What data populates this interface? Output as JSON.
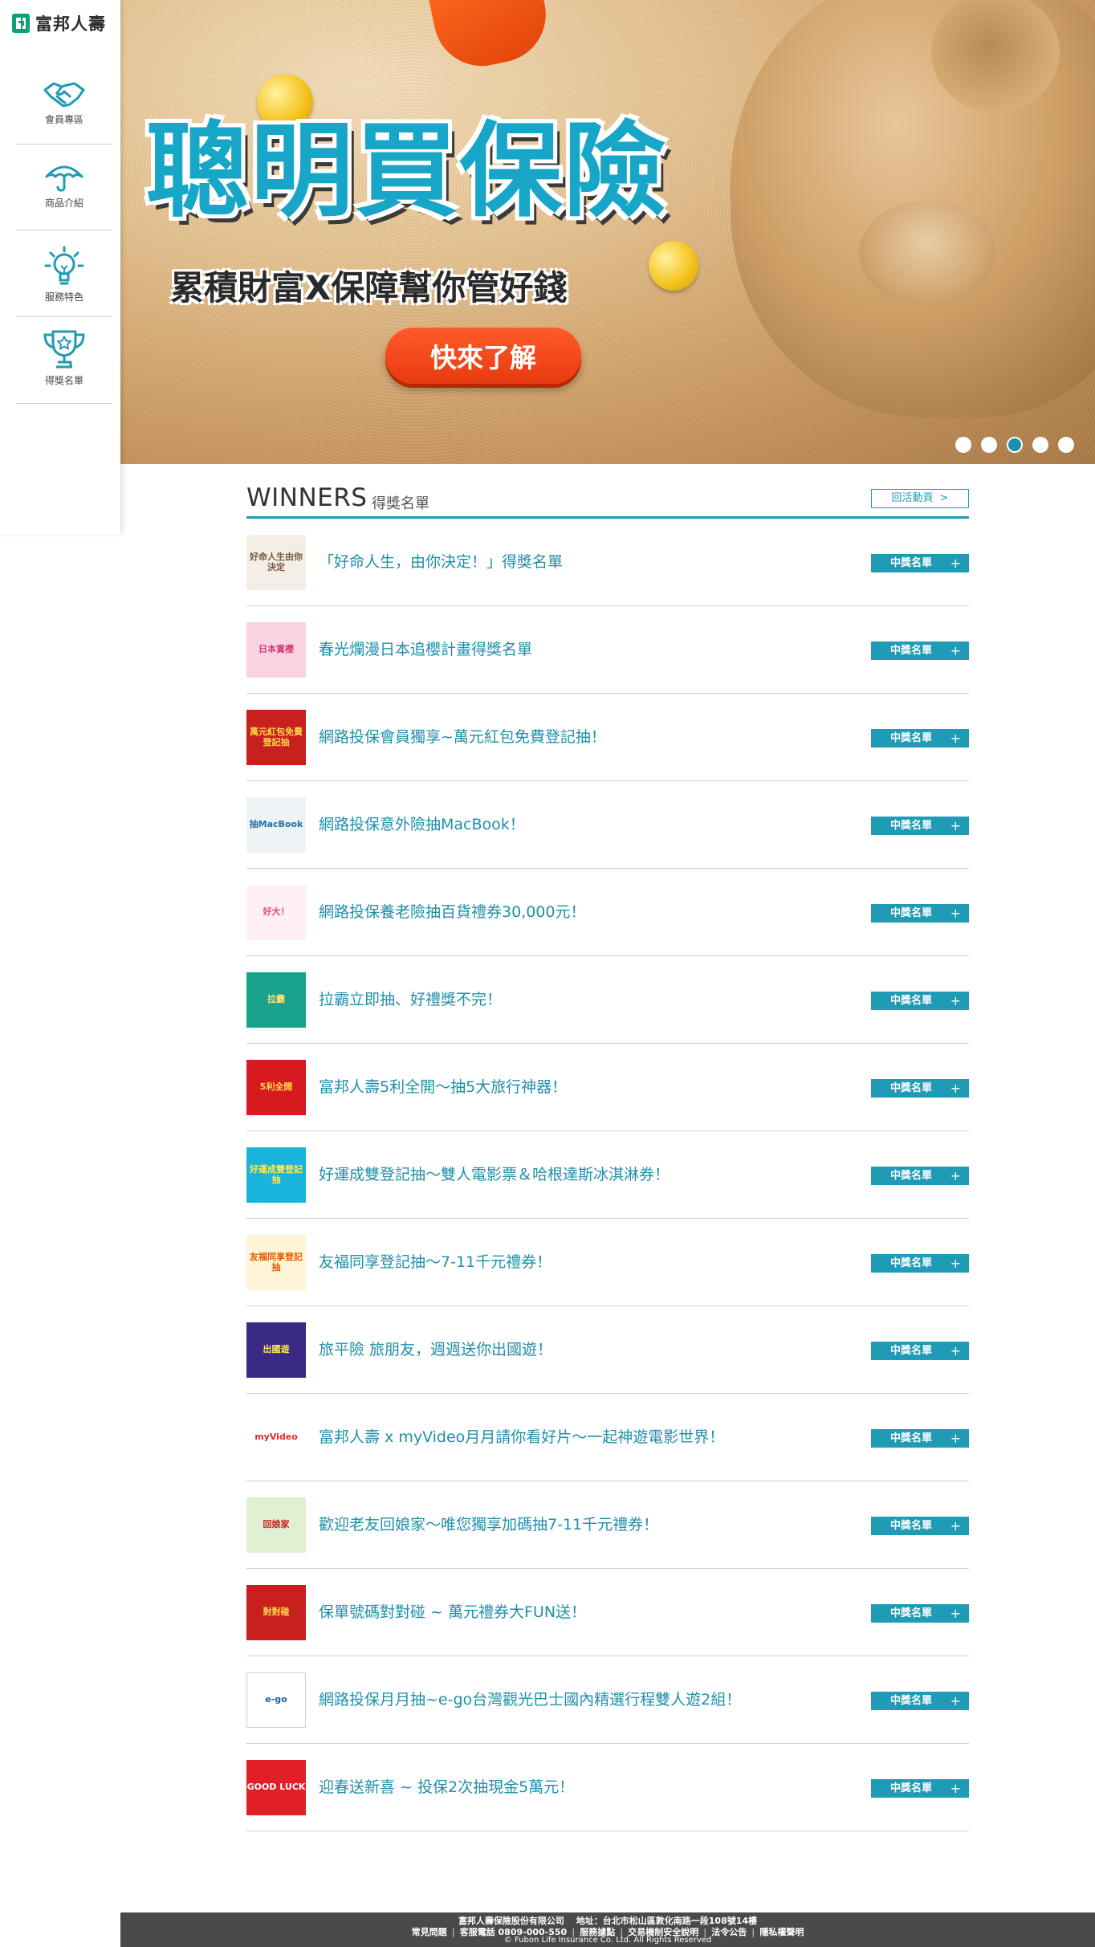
{
  "brand": {
    "name": "富邦人壽",
    "accent": "#1f9bb5"
  },
  "sidebar": {
    "items": [
      {
        "label": "會員專區",
        "icon": "handshake-icon"
      },
      {
        "label": "商品介紹",
        "icon": "umbrella-icon"
      },
      {
        "label": "服務特色",
        "icon": "lightbulb-icon"
      },
      {
        "label": "得獎名單",
        "icon": "trophy-icon"
      }
    ]
  },
  "hero": {
    "title": "聰明買保險",
    "subtitle": "累積財富X保障幫你管好錢",
    "cta": "快來了解",
    "slide_count": 5,
    "active_slide": 3
  },
  "winners": {
    "title": "WINNERS",
    "subtitle": "得獎名單",
    "back_label": "回活動頁",
    "button_label": "中獎名單",
    "items": [
      {
        "title": "「好命人生，由你決定！」得獎名單",
        "thumb_text": "好命人生由你決定"
      },
      {
        "title": "春光爛漫日本追櫻計畫得獎名單",
        "thumb_text": "日本賞櫻"
      },
      {
        "title": "網路投保會員獨享~萬元紅包免費登記抽！",
        "thumb_text": "萬元紅包免費登記抽"
      },
      {
        "title": "網路投保意外險抽MacBook！",
        "thumb_text": "抽MacBook"
      },
      {
        "title": "網路投保養老險抽百貨禮券30,000元！",
        "thumb_text": "好大！"
      },
      {
        "title": "拉霸立即抽、好禮獎不完！",
        "thumb_text": "拉霸"
      },
      {
        "title": "富邦人壽5利全開～抽5大旅行神器！",
        "thumb_text": "5利全開"
      },
      {
        "title": "好運成雙登記抽～雙人電影票＆哈根達斯冰淇淋券！",
        "thumb_text": "好運成雙登記抽"
      },
      {
        "title": "友福同享登記抽～7-11千元禮券！",
        "thumb_text": "友福同享登記抽"
      },
      {
        "title": "旅平險 旅朋友，週週送你出國遊！",
        "thumb_text": "出國遊"
      },
      {
        "title": "富邦人壽 x myVideo月月請你看好片～一起神遊電影世界！",
        "thumb_text": "myVideo"
      },
      {
        "title": "歡迎老友回娘家～唯您獨享加碼抽7-11千元禮券！",
        "thumb_text": "回娘家"
      },
      {
        "title": "保單號碼對對碰 ~ 萬元禮券大FUN送！",
        "thumb_text": "對對碰"
      },
      {
        "title": "網路投保月月抽~e-go台灣觀光巴士國內精選行程雙人遊2組！",
        "thumb_text": "e-go"
      },
      {
        "title": "迎春送新喜 ~ 投保2次抽現金5萬元！",
        "thumb_text": "GOOD LUCK"
      }
    ]
  },
  "footer": {
    "line1": "富邦人壽保險股份有限公司　 地址：台北市松山區敦化南路一段108號14樓",
    "links": [
      "常見問題",
      "客服電話 0809-000-550",
      "服務據點",
      "交易機制安全說明",
      "法令公告",
      "隱私權聲明"
    ],
    "copyright": "© Fubon Life Insurance Co. Ltd. All Rights Reserved"
  }
}
